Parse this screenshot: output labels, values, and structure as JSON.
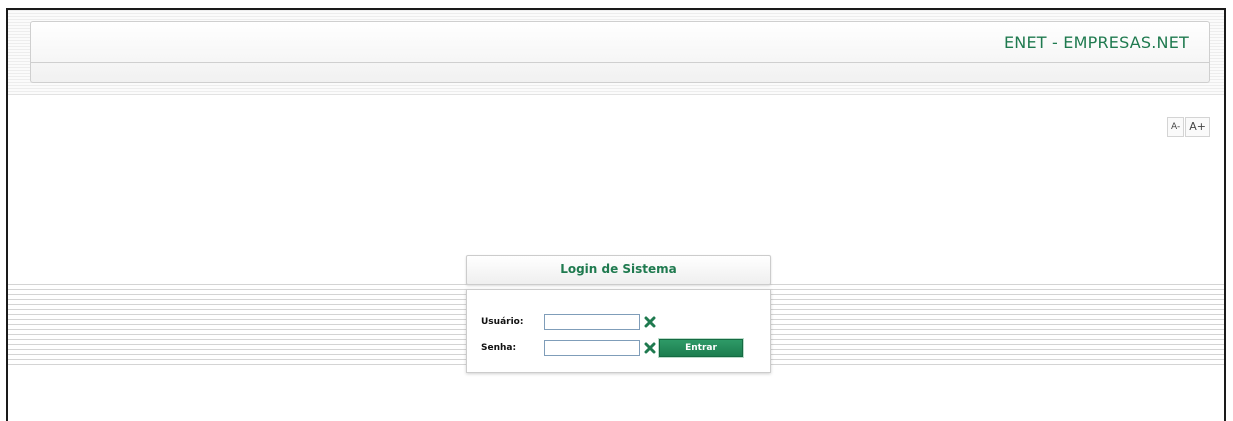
{
  "header": {
    "title": "ENET - EMPRESAS.NET"
  },
  "font_controls": {
    "decrease": "A-",
    "increase": "A+"
  },
  "login": {
    "title": "Login de Sistema",
    "username_label": "Usuário:",
    "username_value": "",
    "password_label": "Senha:",
    "password_value": "",
    "submit_label": "Entrar"
  },
  "colors": {
    "accent": "#1f7a4f",
    "button": "#1c7d4f",
    "clear_icon": "#1f7a4f"
  },
  "icons": {
    "clear": "x-icon"
  }
}
